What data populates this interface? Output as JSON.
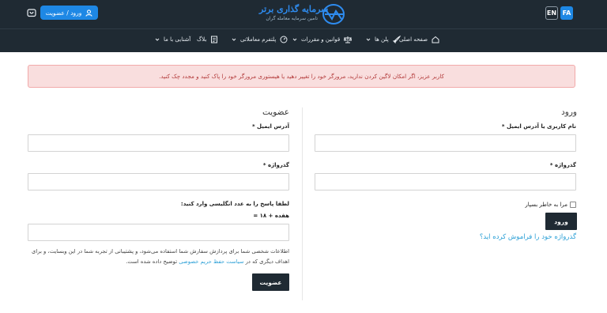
{
  "header": {
    "lang_fa": "FA",
    "lang_en": "EN",
    "logo_title": "سرمایه گذاری برتر",
    "logo_subtitle": "تامین سرمایه معامله گران",
    "login_label": "ورود / عضویت",
    "colors": {
      "bg": "#1f2a33",
      "accent": "#1e88e5"
    }
  },
  "nav": {
    "home": "صفحه اصلی",
    "plans": "پلن ها",
    "rules": "قوانین و مقررات",
    "platforms": "پلتفرم معاملاتی",
    "blog": "بلاگ",
    "about": "آشنایی با ما"
  },
  "alert": {
    "text": "کاربر عزیز، اگر امکان لاگین کردن ندارید، مرورگر خود را تغییر دهید یا هیستوری مرورگر خود را پاک کنید و مجدد چک کنید."
  },
  "login": {
    "title": "ورود",
    "username_label": "نام کاربری یا آدرس ایمیل *",
    "password_label": "گذرواژه *",
    "remember_label": "مرا به خاطر بسپار",
    "submit_label": "ورود",
    "forgot_label": "گذرواژه خود را فراموش کرده اید؟"
  },
  "register": {
    "title": "عضویت",
    "email_label": "آدرس ایمیل *",
    "password_label": "گذرواژه *",
    "captcha_prompt": "لطفا پاسخ را به عدد انگلیسی وارد کنید:",
    "captcha_question": "هفده + ۱۸ =",
    "privacy_text_1": "اطلاعات شخصی شما برای پردازش سفارش شما استفاده می‌شود، و پشتیبانی از تجربه شما در این وبسایت، و برای اهداف دیگری که در",
    "privacy_link": "سیاست حفظ حریم خصوصی",
    "privacy_text_2": "توضیح داده شده است.",
    "submit_label": "عضویت"
  }
}
